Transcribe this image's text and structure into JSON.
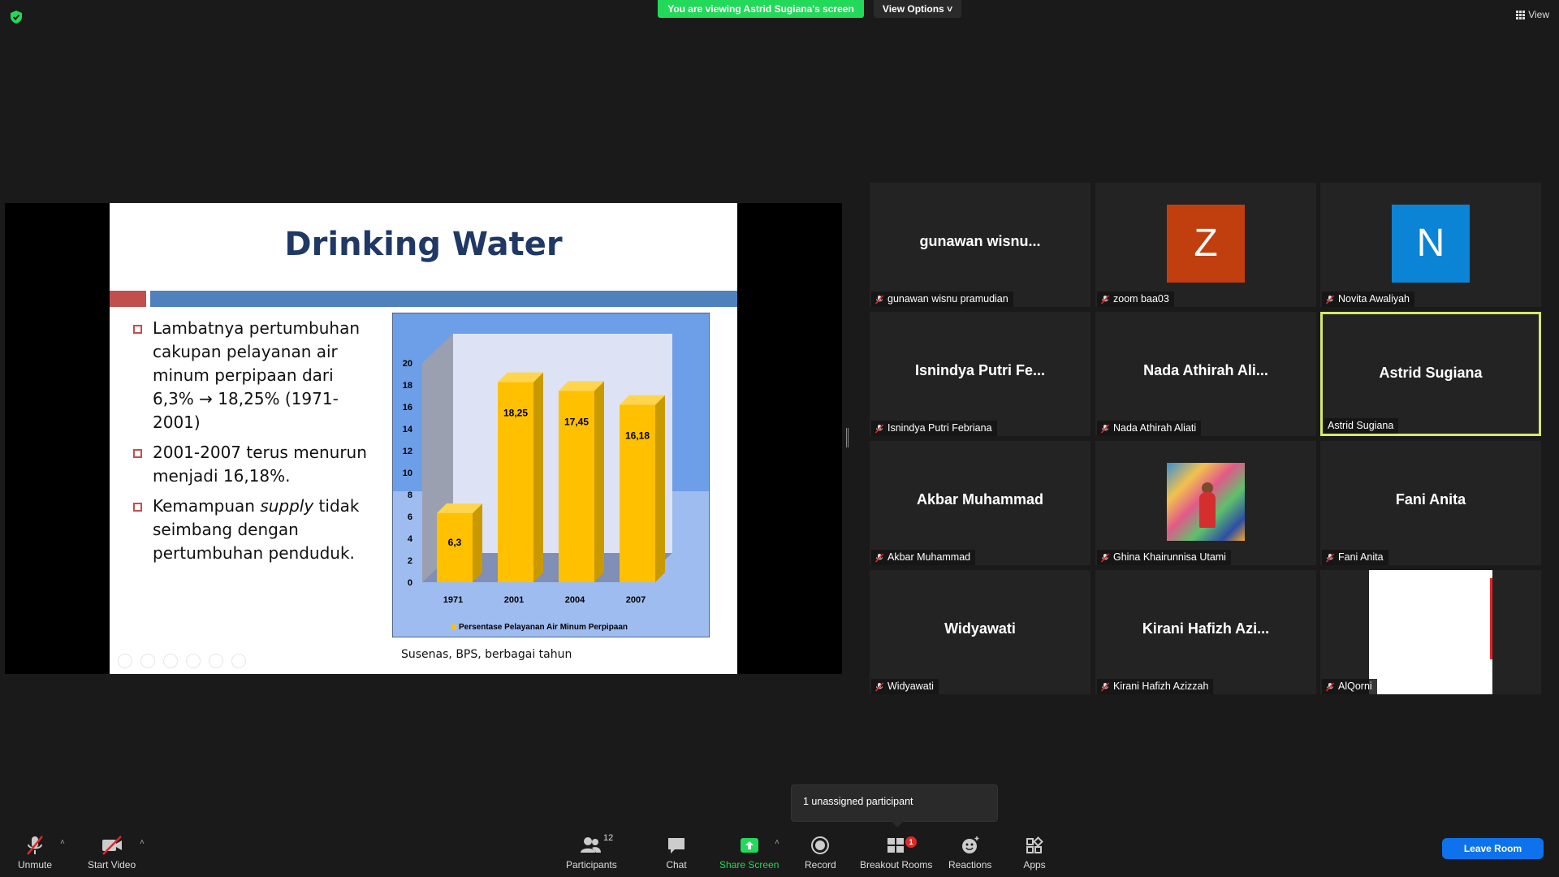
{
  "top_bar": {
    "viewing_banner": "You are viewing Astrid Sugiana's screen",
    "view_options": "View Options",
    "view_button": "View"
  },
  "slide": {
    "title": "Drinking Water",
    "bullets": [
      {
        "text": "Lambatnya pertumbuhan cakupan pelayanan air minum perpipaan dari 6,3% → 18,25% (1971-2001)"
      },
      {
        "text": "2001-2007  terus menurun menjadi 16,18%."
      },
      {
        "pre": "Kemampuan ",
        "em": "supply",
        "post": " tidak seimbang dengan pertumbuhan penduduk."
      }
    ],
    "source": "Susenas, BPS, berbagai tahun"
  },
  "chart_data": {
    "type": "bar",
    "categories": [
      "1971",
      "2001",
      "2004",
      "2007"
    ],
    "values": [
      6.3,
      18.25,
      17.45,
      16.18
    ],
    "data_labels": [
      "6,3",
      "18,25",
      "17,45",
      "16,18"
    ],
    "y_ticks": [
      "0",
      "2",
      "4",
      "6",
      "8",
      "10",
      "12",
      "14",
      "16",
      "18",
      "20"
    ],
    "ylim": [
      0,
      20
    ],
    "legend": "Persentase Pelayanan Air Minum Perpipaan",
    "legend_position": "bottom",
    "colors": {
      "bar": "#ffc000",
      "bar_side": "#c99a00",
      "back_wall": "#dde3f5",
      "plot_bg": "#6d9ee8"
    }
  },
  "participants": [
    {
      "display": "gunawan wisnu...",
      "label": "gunawan wisnu pramudian",
      "kind": "name"
    },
    {
      "display": "Z",
      "label": "zoom baa03",
      "kind": "avatar",
      "color": "#c13e0f"
    },
    {
      "display": "N",
      "label": "Novita Awaliyah",
      "kind": "avatar",
      "color": "#0b84d6"
    },
    {
      "display": "Isnindya Putri Fe...",
      "label": "Isnindya Putri Febriana",
      "kind": "name"
    },
    {
      "display": "Nada Athirah Ali...",
      "label": "Nada Athirah Aliati",
      "kind": "name"
    },
    {
      "display": "Astrid Sugiana",
      "label": "Astrid Sugiana",
      "kind": "name",
      "active": true
    },
    {
      "display": "Akbar Muhammad",
      "label": "Akbar Muhammad",
      "kind": "name"
    },
    {
      "display": "",
      "label": "Ghina Khairunnisa Utami",
      "kind": "photo"
    },
    {
      "display": "Fani Anita",
      "label": "Fani Anita",
      "kind": "name"
    },
    {
      "display": "Widyawati",
      "label": "Widyawati",
      "kind": "name"
    },
    {
      "display": "Kirani Hafizh Azi...",
      "label": "Kirani Hafizh Azizzah",
      "kind": "name"
    },
    {
      "display": "",
      "label": "AlQorni",
      "kind": "video"
    }
  ],
  "tooltip": "1 unassigned participant",
  "toolbar": {
    "unmute": "Unmute",
    "start_video": "Start Video",
    "participants": "Participants",
    "participants_count": "12",
    "chat": "Chat",
    "share_screen": "Share Screen",
    "record": "Record",
    "breakout_rooms": "Breakout Rooms",
    "breakout_badge": "1",
    "reactions": "Reactions",
    "apps": "Apps",
    "leave": "Leave Room"
  }
}
